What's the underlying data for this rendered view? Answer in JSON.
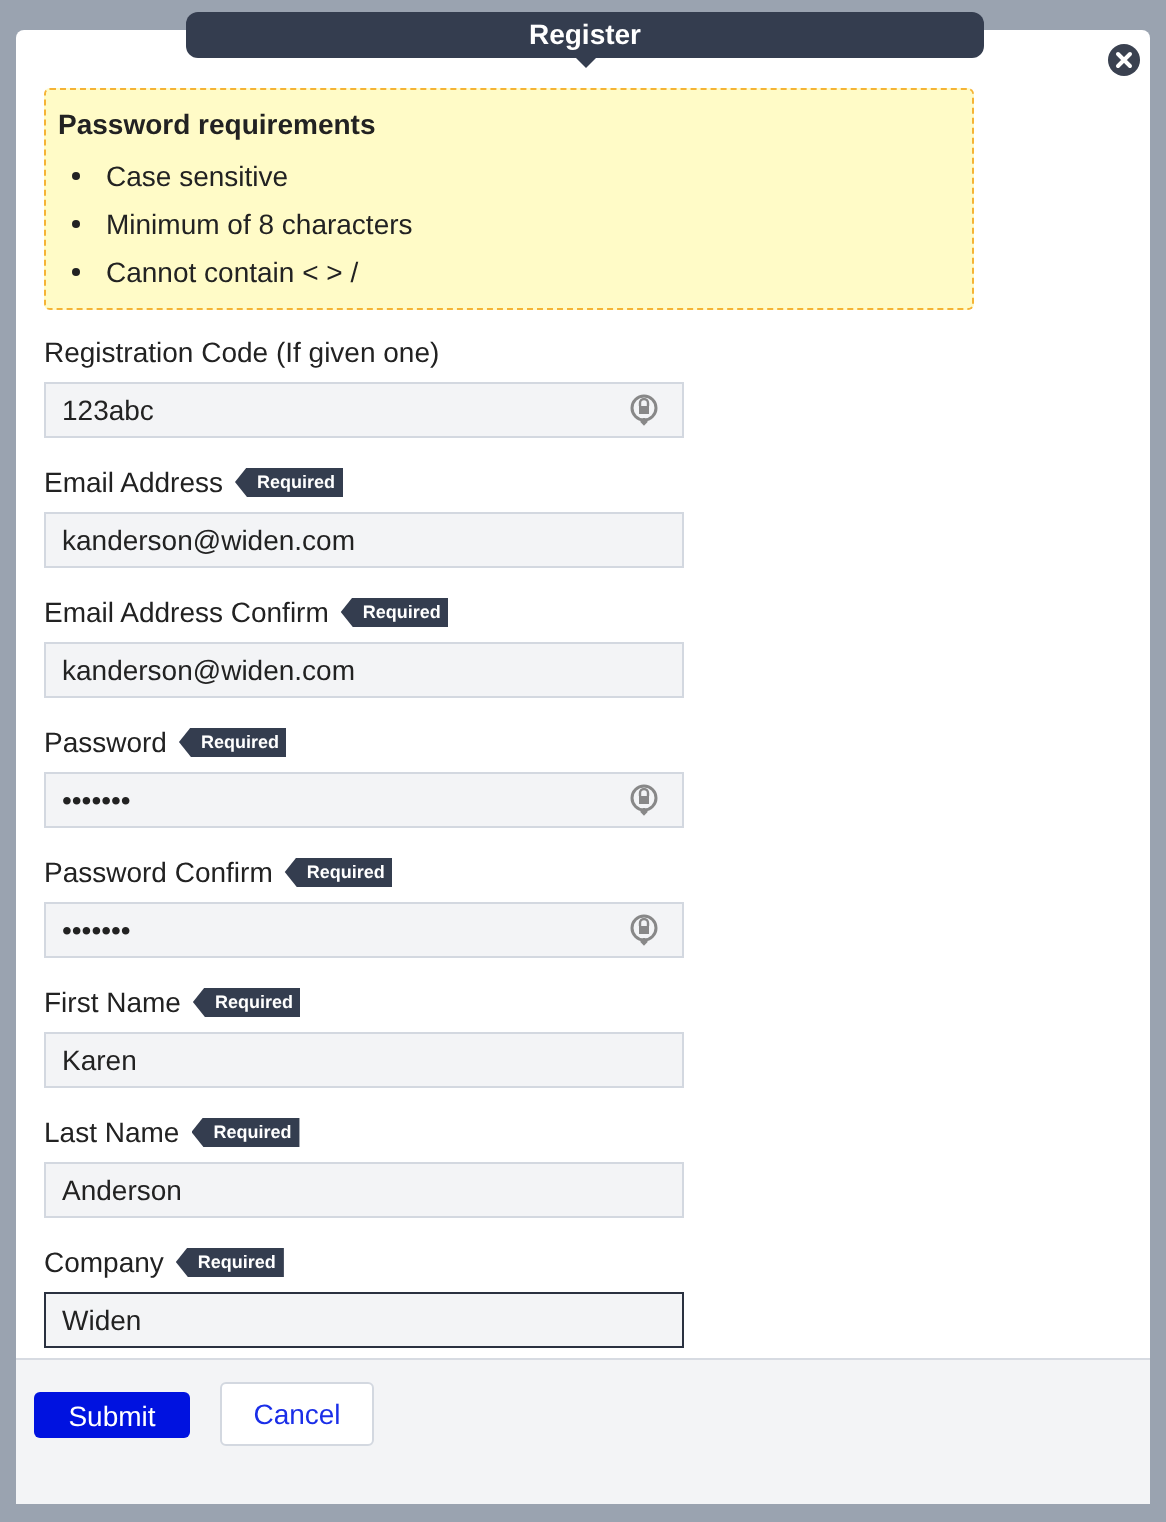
{
  "dialog": {
    "title": "Register"
  },
  "requirements": {
    "title": "Password requirements",
    "items": [
      "Case sensitive",
      "Minimum of 8 characters",
      "Cannot contain < > /"
    ]
  },
  "fields": [
    {
      "label": "Registration Code (If given one)",
      "required": false,
      "value": "123abc",
      "key_icon": true,
      "focused": false
    },
    {
      "label": "Email Address",
      "required": true,
      "badge": "Required",
      "value": "kanderson@widen.com",
      "key_icon": false,
      "focused": false
    },
    {
      "label": "Email Address Confirm",
      "required": true,
      "badge": "Required",
      "value": "kanderson@widen.com",
      "key_icon": false,
      "focused": false
    },
    {
      "label": "Password",
      "required": true,
      "badge": "Required",
      "value": "•••••••",
      "key_icon": true,
      "focused": false
    },
    {
      "label": "Password Confirm",
      "required": true,
      "badge": "Required",
      "value": "•••••••",
      "key_icon": true,
      "focused": false
    },
    {
      "label": "First Name",
      "required": true,
      "badge": "Required",
      "value": "Karen",
      "key_icon": false,
      "focused": false
    },
    {
      "label": "Last Name",
      "required": true,
      "badge": "Required",
      "value": "Anderson",
      "key_icon": false,
      "focused": false
    },
    {
      "label": "Company",
      "required": true,
      "badge": "Required",
      "value": "Widen",
      "key_icon": false,
      "focused": true
    }
  ],
  "buttons": {
    "submit": "Submit",
    "cancel": "Cancel"
  }
}
